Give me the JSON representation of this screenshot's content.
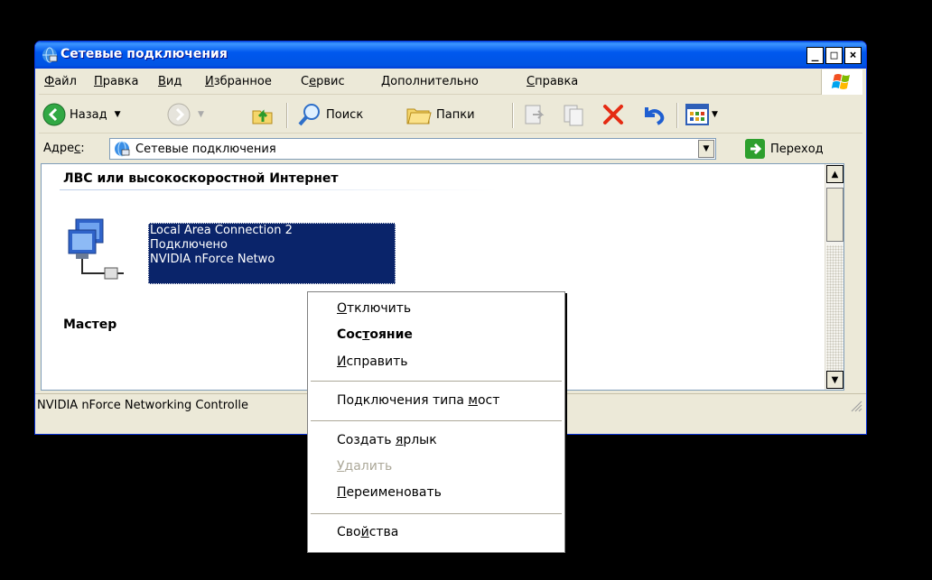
{
  "window": {
    "title": "Сетевые подключения",
    "minimize_glyph": "_",
    "maximize_glyph": "□",
    "close_glyph": "×"
  },
  "menu": {
    "items": [
      {
        "accel": "Ф",
        "rest": "айл"
      },
      {
        "accel": "П",
        "rest": "равка"
      },
      {
        "accel": "В",
        "rest": "ид"
      },
      {
        "accel": "И",
        "rest": "збранное"
      },
      {
        "pre": "С",
        "accel": "е",
        "rest": "рвис"
      },
      {
        "accel": "Д",
        "rest": "ополнительно"
      },
      {
        "accel": "С",
        "rest": "правка"
      }
    ]
  },
  "toolbar": {
    "back_label": "Назад",
    "search_label": "Поиск",
    "folders_label": "Папки"
  },
  "address": {
    "label_pre": "Адре",
    "label_accel": "с",
    "label_post": ":",
    "value": "Сетевые подключения",
    "go_label": "Переход"
  },
  "content": {
    "group1_title": "ЛВС или высокоскоростной Интернет",
    "group2_title": "Мастер",
    "connection": {
      "name": "Local Area Connection 2",
      "status": "Подключено",
      "device": "NVIDIA nForce Netwo"
    }
  },
  "statusbar": {
    "text": "NVIDIA nForce Networking Controlle"
  },
  "context_menu": {
    "disconnect": {
      "accel": "О",
      "rest": "тключить"
    },
    "status": {
      "pre": "Сос",
      "accel": "т",
      "rest": "ояние"
    },
    "repair": {
      "accel": "И",
      "rest": "справить"
    },
    "bridge": {
      "pre": "Подключения типа ",
      "accel": "м",
      "rest": "ост"
    },
    "shortcut": {
      "pre": "Создать ",
      "accel": "я",
      "rest": "рлык"
    },
    "delete": {
      "accel": "У",
      "rest": "далить"
    },
    "rename": {
      "accel": "П",
      "rest": "ереименовать"
    },
    "properties": {
      "pre": "Сво",
      "accel": "й",
      "rest": "ства"
    }
  },
  "colors": {
    "titlebar": "#0054e3",
    "selection": "#0a246a",
    "close_red": "#e52b13",
    "go_green": "#2d9f2d",
    "back_green": "#31a844"
  }
}
